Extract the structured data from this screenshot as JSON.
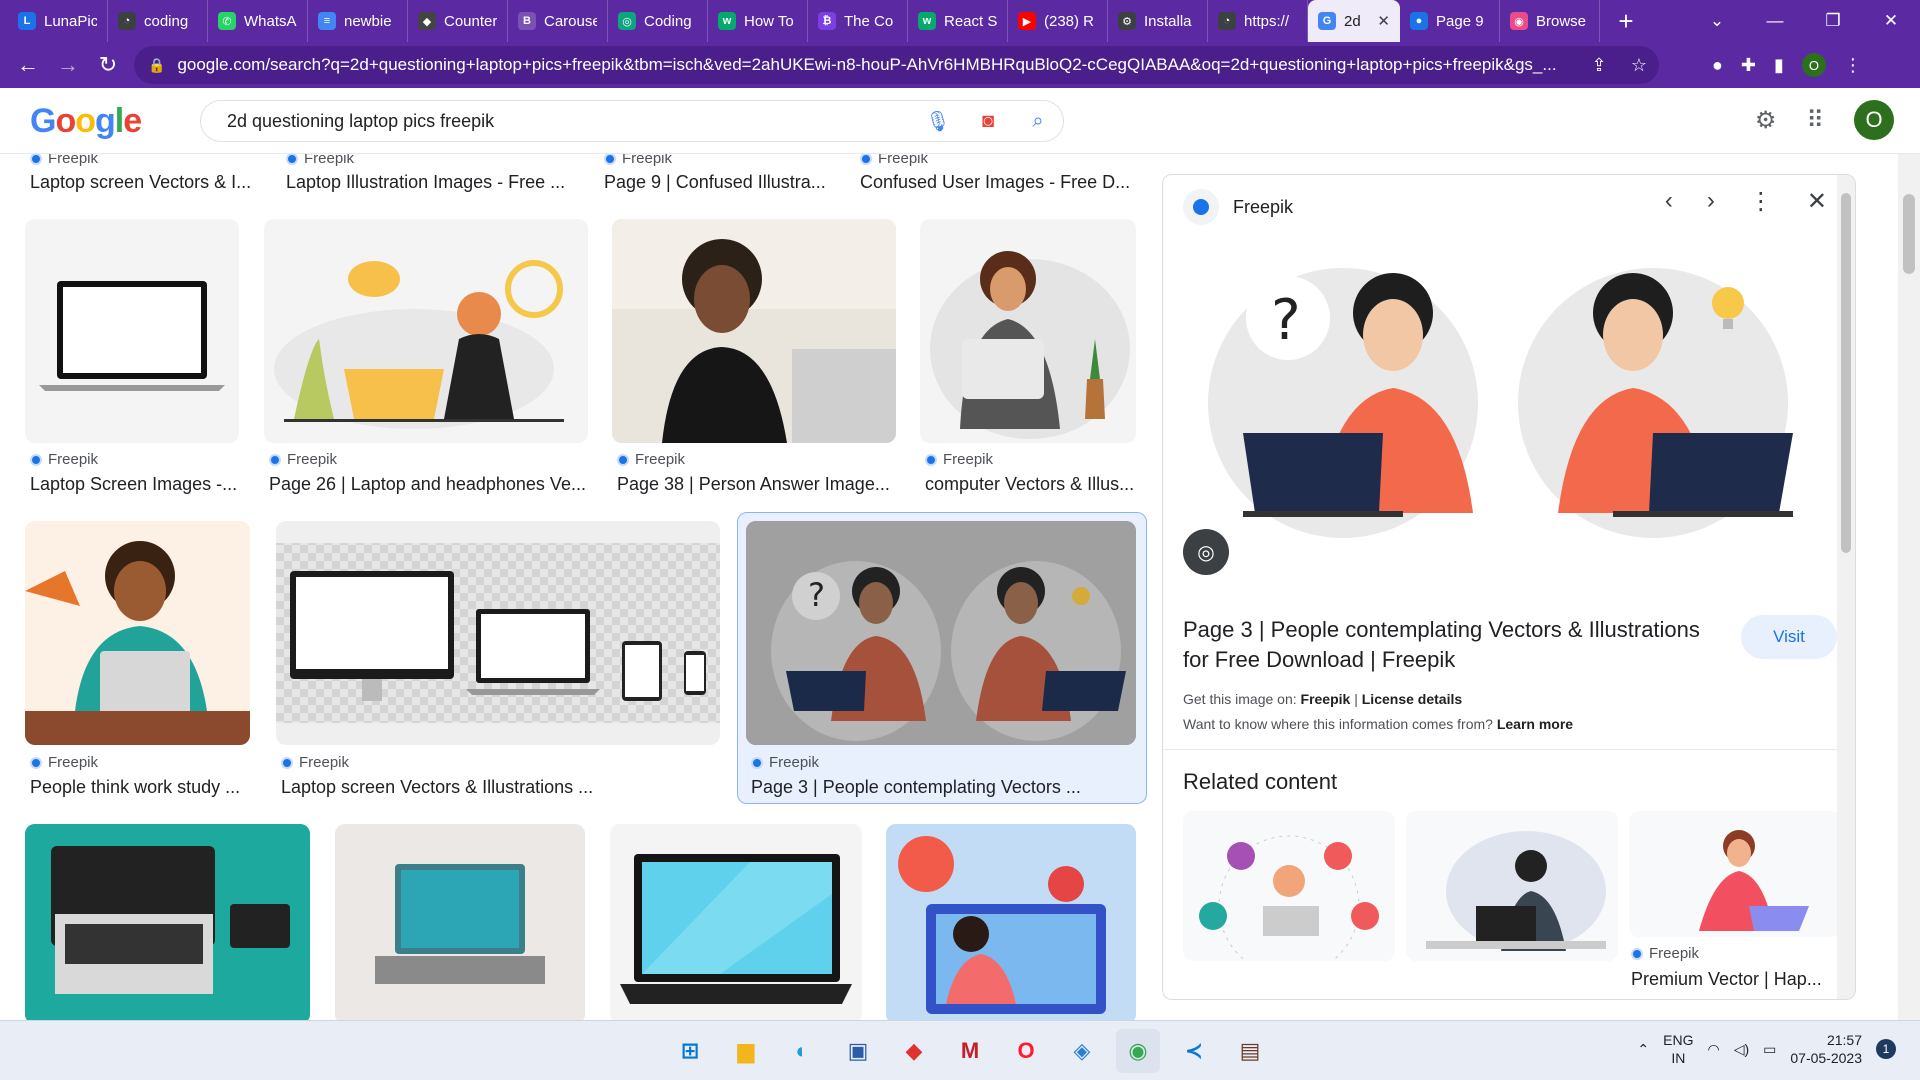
{
  "tabs": [
    {
      "label": "LunaPic",
      "color": "#1a73e8",
      "glyph": "L"
    },
    {
      "label": "coding",
      "color": "#3c4043",
      "glyph": "◔"
    },
    {
      "label": "WhatsApp",
      "color": "#25d366",
      "glyph": "✆"
    },
    {
      "label": "newbie",
      "color": "#4285f4",
      "glyph": "≡"
    },
    {
      "label": "Counter",
      "color": "#444444",
      "glyph": "◆"
    },
    {
      "label": "Carousel",
      "color": "#7952b3",
      "glyph": "B"
    },
    {
      "label": "Coding",
      "color": "#10a37f",
      "glyph": "◎"
    },
    {
      "label": "How To",
      "color": "#04aa6d",
      "glyph": "w"
    },
    {
      "label": "The Co",
      "color": "#7b3fe4",
      "glyph": "₿"
    },
    {
      "label": "React S",
      "color": "#04aa6d",
      "glyph": "w"
    },
    {
      "label": "(238) R",
      "color": "#ff0000",
      "glyph": "▶"
    },
    {
      "label": "Installa",
      "color": "#3c4043",
      "glyph": "⚙"
    },
    {
      "label": "https://",
      "color": "#3c4043",
      "glyph": "◔"
    },
    {
      "label": "2d",
      "color": "#4285f4",
      "glyph": "G"
    },
    {
      "label": "Page 9",
      "color": "#1a73e8",
      "glyph": "●"
    },
    {
      "label": "Browse",
      "color": "#ea4c89",
      "glyph": "◉"
    }
  ],
  "omnibox": {
    "url": "google.com/search?q=2d+questioning+laptop+pics+freepik&tbm=isch&ved=2ahUKEwi-n8-houP-AhVr6HMBHRquBloQ2-cCegQIABAA&oq=2d+questioning+laptop+pics+freepik&gs_..."
  },
  "profile_initial": "O",
  "search": {
    "query": "2d questioning laptop pics freepik"
  },
  "google_logo": [
    "G",
    "o",
    "o",
    "g",
    "l",
    "e"
  ],
  "results": {
    "row0": [
      {
        "source": "Freepik",
        "title": "Laptop screen Vectors & I..."
      },
      {
        "source": "Freepik",
        "title": "Laptop Illustration Images - Free ..."
      },
      {
        "source": "Freepik",
        "title": "Page 9 | Confused Illustra..."
      },
      {
        "source": "Freepik",
        "title": "Confused User Images - Free D..."
      }
    ],
    "row1": [
      {
        "source": "Freepik",
        "title": "Laptop Screen Images -..."
      },
      {
        "source": "Freepik",
        "title": "Page 26 | Laptop and headphones Ve..."
      },
      {
        "source": "Freepik",
        "title": "Page 38 | Person Answer Image..."
      },
      {
        "source": "Freepik",
        "title": "computer Vectors & Illus..."
      }
    ],
    "row2": [
      {
        "source": "Freepik",
        "title": "People think work study ..."
      },
      {
        "source": "Freepik",
        "title": "Laptop screen Vectors & Illustrations ..."
      },
      {
        "source": "Freepik",
        "title": "Page 3 | People contemplating Vectors ..."
      }
    ]
  },
  "panel": {
    "source": "Freepik",
    "title": "Page 3 | People contemplating Vectors & Illustrations for Free Download | Freepik",
    "visit_label": "Visit",
    "get_image_prefix": "Get this image on:",
    "get_image_source": "Freepik",
    "separator": "|",
    "license": "License details",
    "info_question": "Want to know where this information comes from?",
    "learn_more": "Learn more",
    "related_heading": "Related content",
    "related": [
      {
        "source": "",
        "title": ""
      },
      {
        "source": "",
        "title": ""
      },
      {
        "source": "Freepik",
        "title": "Premium Vector | Hap..."
      }
    ]
  },
  "taskbar": {
    "lang_line1": "ENG",
    "lang_line2": "IN",
    "time": "21:57",
    "date": "07-05-2023",
    "notifications": "1"
  }
}
